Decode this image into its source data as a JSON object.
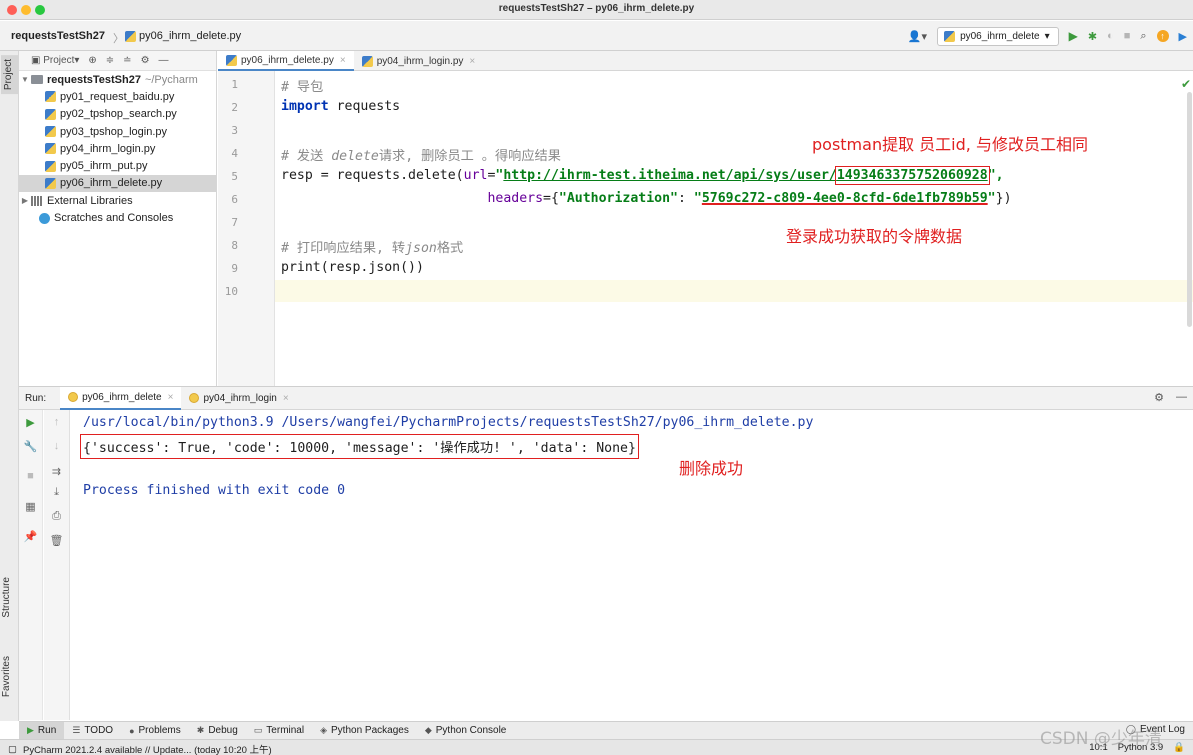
{
  "window": {
    "title": "requestsTestSh27 – py06_ihrm_delete.py"
  },
  "navbar": {
    "project": "requestsTestSh27",
    "separator": "〉",
    "file": "py06_ihrm_delete.py",
    "run_config": "py06_ihrm_delete"
  },
  "side_tabs": {
    "project": "Project",
    "structure": "Structure",
    "favorites": "Favorites"
  },
  "project_panel": {
    "header": "Project",
    "root": {
      "name": "requestsTestSh27",
      "path": "~/Pycharm"
    },
    "files": [
      "py01_request_baidu.py",
      "py02_tpshop_search.py",
      "py03_tpshop_login.py",
      "py04_ihrm_login.py",
      "py05_ihrm_put.py",
      "py06_ihrm_delete.py"
    ],
    "external_libraries": "External Libraries",
    "scratches": "Scratches and Consoles"
  },
  "editor": {
    "tabs": [
      "py06_ihrm_delete.py",
      "py04_ihrm_login.py"
    ],
    "line_numbers": [
      "1",
      "2",
      "3",
      "4",
      "5",
      "6",
      "7",
      "8",
      "9",
      "10"
    ],
    "code": {
      "l1_comment": "# 导包",
      "l2_kw": "import",
      "l2_rest": " requests",
      "l4_hash": "# 发送 ",
      "l4_italic": "delete",
      "l4_rest": "请求, 删除员工 。得响应结果",
      "l5_start": "resp = requests.delete(",
      "l5_param": "url",
      "l5_eq": "=",
      "l5_q": "\"",
      "l5_url": "http://ihrm-test.itheima.net/api/sys/user/",
      "l5_id": "1493463375752060928",
      "l5_end": "\",",
      "l6_indent": "                          ",
      "l6_param": "headers",
      "l6_eq": "={",
      "l6_key": "\"Authorization\"",
      "l6_colon": ": ",
      "l6_q": "\"",
      "l6_token": "5769c272-c809-4ee0-8cfd-6de1fb789b59",
      "l6_end_q": "\"",
      "l6_end": "})",
      "l8_hash": "# 打印响应结果, 转",
      "l8_italic": "json",
      "l8_rest": "格式",
      "l9": "print(resp.json())"
    },
    "annotations": {
      "id_note": "postman提取 员工id, 与修改员工相同",
      "token_note": "登录成功获取的令牌数据"
    }
  },
  "run_panel": {
    "label": "Run:",
    "tabs": [
      "py06_ihrm_delete",
      "py04_ihrm_login"
    ],
    "console": {
      "command": "/usr/local/bin/python3.9 /Users/wangfei/PycharmProjects/requestsTestSh27/py06_ihrm_delete.py",
      "result": "{'success': True, 'code': 10000, 'message': '操作成功! ', 'data': None}",
      "exit": "Process finished with exit code 0"
    },
    "annotation": "删除成功"
  },
  "bottom_tabs": [
    "Run",
    "TODO",
    "Problems",
    "Debug",
    "Terminal",
    "Python Packages",
    "Python Console"
  ],
  "event_log": "Event Log",
  "statusbar": {
    "message": "PyCharm 2021.2.4 available // Update... (today 10:20 上午)",
    "position": "10:1",
    "interpreter": "Python 3.9"
  },
  "watermark": "CSDN @少年清"
}
